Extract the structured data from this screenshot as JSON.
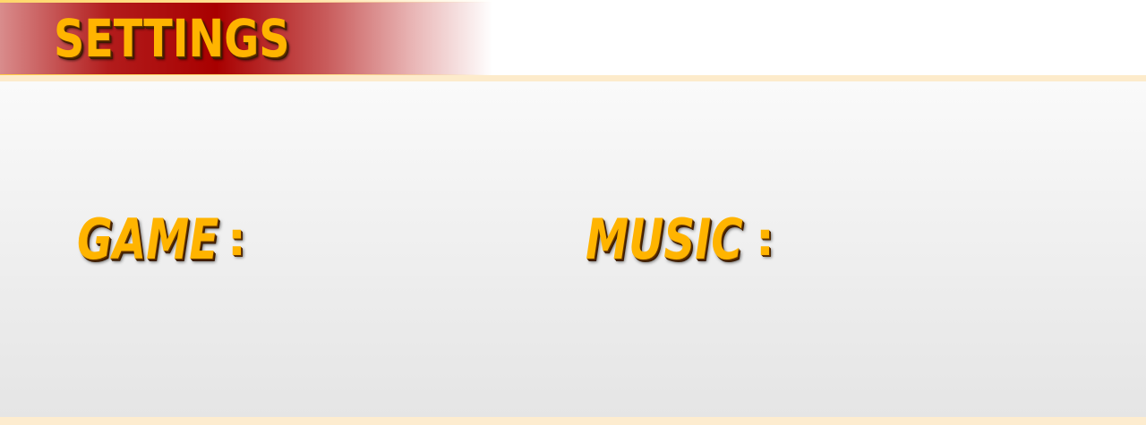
{
  "header": {
    "title": "SETTINGS"
  },
  "settings": {
    "game": {
      "label": "GAME",
      "separator": ":"
    },
    "music": {
      "label": "MUSIC",
      "separator": ":"
    }
  },
  "colors": {
    "title_text": "#ffb400",
    "banner_red": "#a80000",
    "accent_rule": "#fdebcb",
    "panel_top": "#fafafa",
    "panel_bottom": "#e5e5e5"
  }
}
